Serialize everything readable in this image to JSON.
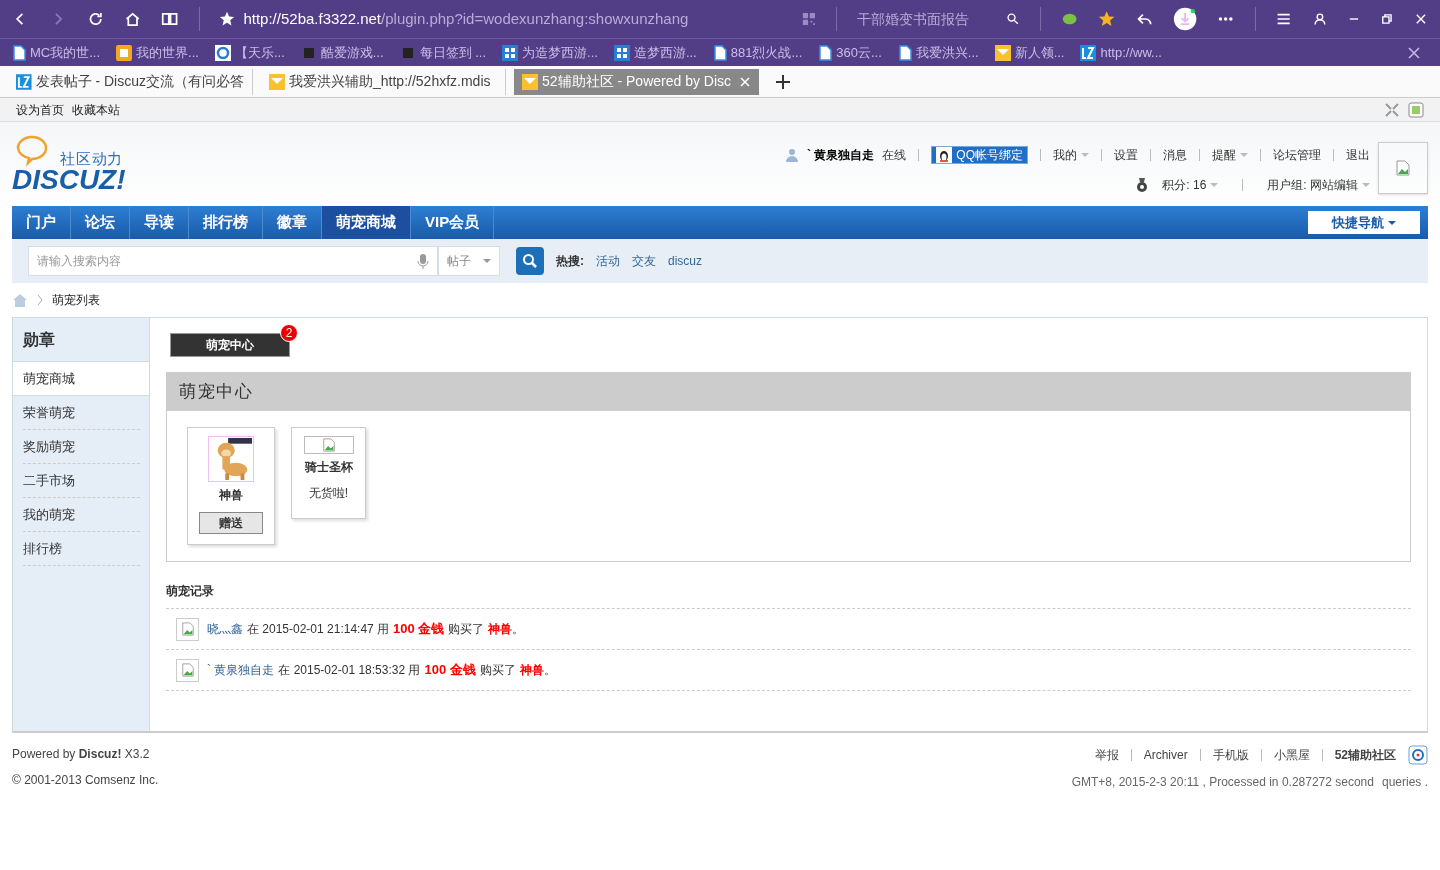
{
  "browser": {
    "url": {
      "host": "http://52ba.f3322.net",
      "path": "/plugin.php?id=wodexunzhang:showxunzhang"
    },
    "search": {
      "placeholder": "干部婚变书面报告"
    },
    "bookmarks": [
      {
        "label": "MC我的世...",
        "kind": "page"
      },
      {
        "label": "我的世界...",
        "kind": "orange"
      },
      {
        "label": "【天乐...",
        "kind": "ring"
      },
      {
        "label": "酷爱游戏...",
        "kind": "char"
      },
      {
        "label": "每日签到 ...",
        "kind": "char"
      },
      {
        "label": "为造梦西游...",
        "kind": "grid"
      },
      {
        "label": "造梦西游...",
        "kind": "grid"
      },
      {
        "label": "881烈火战...",
        "kind": "page"
      },
      {
        "label": "360云...",
        "kind": "page"
      },
      {
        "label": "我爱洪兴...",
        "kind": "page"
      },
      {
        "label": "新人领...",
        "kind": "yellow"
      },
      {
        "label": "http://ww...",
        "kind": "lz"
      }
    ],
    "tabs": [
      {
        "title": "发表帖子 - Discuz交流（有问必答",
        "selected": false
      },
      {
        "title": "我爱洪兴辅助_http://52hxfz.mdis",
        "selected": false
      },
      {
        "title": "52辅助社区 - Powered by Disc",
        "selected": true
      }
    ],
    "toolbar": [
      "设为首页",
      "收藏本站"
    ]
  },
  "site": {
    "logo": {
      "tagline": "社区动力",
      "wordmark": "DISCUZ!"
    },
    "user": {
      "name": "` 黄泉独自走",
      "status": "在线",
      "qq": "QQ帐号绑定",
      "links": [
        {
          "label": "我的",
          "dropdown": true
        },
        {
          "label": "设置",
          "dropdown": false
        },
        {
          "label": "消息",
          "dropdown": false
        },
        {
          "label": "提醒",
          "dropdown": true
        },
        {
          "label": "论坛管理",
          "dropdown": false
        },
        {
          "label": "退出",
          "dropdown": false
        }
      ],
      "points": "积分: 16",
      "group": "用户组: 网站编辑"
    },
    "nav": [
      {
        "label": "门户",
        "selected": false
      },
      {
        "label": "论坛",
        "selected": false
      },
      {
        "label": "导读",
        "selected": false
      },
      {
        "label": "排行榜",
        "selected": false
      },
      {
        "label": "徽章",
        "selected": false
      },
      {
        "label": "萌宠商城",
        "selected": true
      },
      {
        "label": "VIP会员",
        "selected": false
      }
    ],
    "quick_nav": "快捷导航",
    "search": {
      "placeholder": "请输入搜索内容",
      "type": "帖子",
      "hot_label": "热搜:",
      "hot": [
        "活动",
        "交友",
        "discuz"
      ]
    },
    "breadcrumb": "萌宠列表",
    "sidebar": {
      "title": "勋章",
      "items": [
        {
          "label": "萌宠商城",
          "selected": true
        },
        {
          "label": "荣誉萌宠",
          "selected": false
        },
        {
          "label": "奖励萌宠",
          "selected": false
        },
        {
          "label": "二手市场",
          "selected": false
        },
        {
          "label": "我的萌宠",
          "selected": false
        },
        {
          "label": "排行榜",
          "selected": false
        }
      ]
    },
    "tab": {
      "label": "萌宠中心",
      "badge": "2"
    },
    "panel": {
      "title": "萌宠中心",
      "goods": [
        {
          "name": "神兽",
          "kind": "button",
          "action": "赠送"
        },
        {
          "name": "骑士圣杯",
          "kind": "status",
          "action": "无货啦!"
        }
      ]
    },
    "records": {
      "title": "萌宠记录",
      "rows": [
        {
          "user": "晓灬鑫",
          "before": "在 2015-02-01 21:14:47 用",
          "amount": "100 金钱",
          "middle": "购买了",
          "item": "神兽",
          "end": "。"
        },
        {
          "user": "` 黄泉独自走",
          "before": "在 2015-02-01 18:53:32 用",
          "amount": "100 金钱",
          "middle": "购买了",
          "item": "神兽",
          "end": "。"
        }
      ]
    },
    "footer": {
      "powered": "Powered by **Discuz!** X3.2",
      "copyright": "© 2001-2013 Comsenz Inc.",
      "links": [
        "举报",
        "Archiver",
        "手机版",
        "小黑屋",
        "52辅助社区"
      ],
      "info_start": "GMT+8, 2015-2-3 20:11 , Processed in 0.287272 second",
      "info_end": "queries ."
    }
  }
}
